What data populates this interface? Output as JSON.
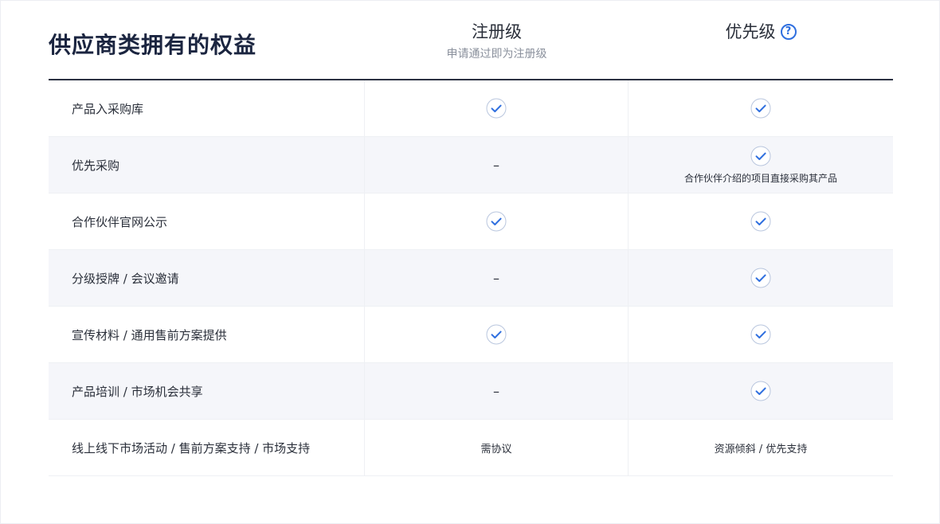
{
  "title": "供应商类拥有的权益",
  "tiers": {
    "registered": {
      "name": "注册级",
      "subtitle": "申请通过即为注册级"
    },
    "priority": {
      "name": "优先级",
      "help": "?"
    }
  },
  "rows": [
    {
      "label": "产品入采购库",
      "registered": {
        "type": "check"
      },
      "priority": {
        "type": "check"
      }
    },
    {
      "label": "优先采购",
      "registered": {
        "type": "dash",
        "text": "–"
      },
      "priority": {
        "type": "check",
        "note": "合作伙伴介绍的项目直接采购其产品"
      }
    },
    {
      "label": "合作伙伴官网公示",
      "registered": {
        "type": "check"
      },
      "priority": {
        "type": "check"
      }
    },
    {
      "label": "分级授牌 / 会议邀请",
      "registered": {
        "type": "dash",
        "text": "–"
      },
      "priority": {
        "type": "check"
      }
    },
    {
      "label": "宣传材料 / 通用售前方案提供",
      "registered": {
        "type": "check"
      },
      "priority": {
        "type": "check"
      }
    },
    {
      "label": "产品培训 / 市场机会共享",
      "registered": {
        "type": "dash",
        "text": "–"
      },
      "priority": {
        "type": "check"
      }
    },
    {
      "label": "线上线下市场活动 / 售前方案支持 / 市场支持",
      "registered": {
        "type": "text",
        "text": "需协议"
      },
      "priority": {
        "type": "text",
        "text": "资源倾斜 / 优先支持"
      }
    }
  ],
  "icons": {
    "check": "check-circle-icon",
    "help": "question-circle-icon"
  },
  "colors": {
    "accent": "#2f6fdf",
    "title": "#1b2540",
    "alt_row": "#f5f6fa",
    "divider": "#2b3142"
  }
}
